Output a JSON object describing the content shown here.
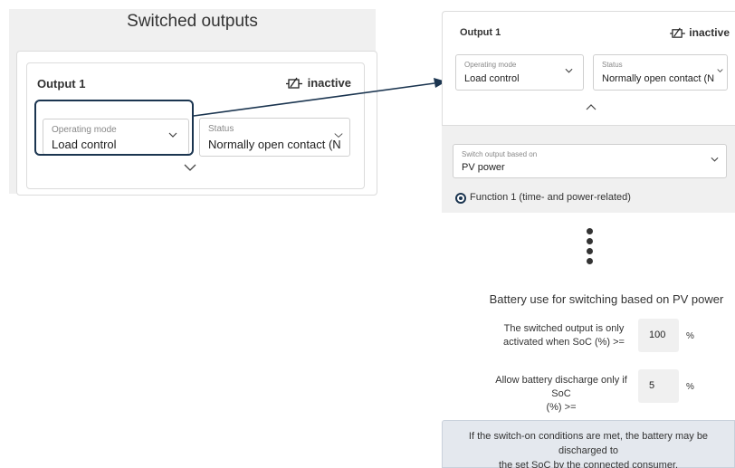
{
  "left": {
    "title": "Switched outputs",
    "output_title": "Output 1",
    "status_text": "inactive",
    "operating_mode": {
      "label": "Operating mode",
      "value": "Load control"
    },
    "status_field": {
      "label": "Status",
      "value": "Normally open contact (N"
    }
  },
  "right": {
    "output_title": "Output 1",
    "status_text": "inactive",
    "operating_mode": {
      "label": "Operating mode",
      "value": "Load control"
    },
    "status_field": {
      "label": "Status",
      "value": "Normally open contact (N"
    },
    "switch_output": {
      "label": "Switch output based on",
      "value": "PV power"
    },
    "function_option": "Function 1 (time- and power-related)",
    "battery_heading": "Battery use for switching based on PV power",
    "soc_activation": {
      "label_line1": "The switched output is only",
      "label_line2": "activated when SoC (%) >=",
      "value": "100",
      "unit": "%"
    },
    "soc_discharge": {
      "label_line1": "Allow battery discharge only if SoC",
      "label_line2": "(%) >=",
      "value": "5",
      "unit": "%"
    },
    "info_line1": "If the switch-on conditions are met, the battery may be discharged to",
    "info_line2": "the set SoC by the connected consumer."
  },
  "icons": {
    "chevron": "chevron-down-icon",
    "chevron_up": "chevron-up-icon",
    "relay": "relay-switch-icon",
    "ellipsis": "vertical-ellipsis-icon"
  },
  "colors": {
    "highlight": "#1b3550",
    "panel_bg": "#f0f0f0",
    "info_bg": "#e4e8ee"
  }
}
